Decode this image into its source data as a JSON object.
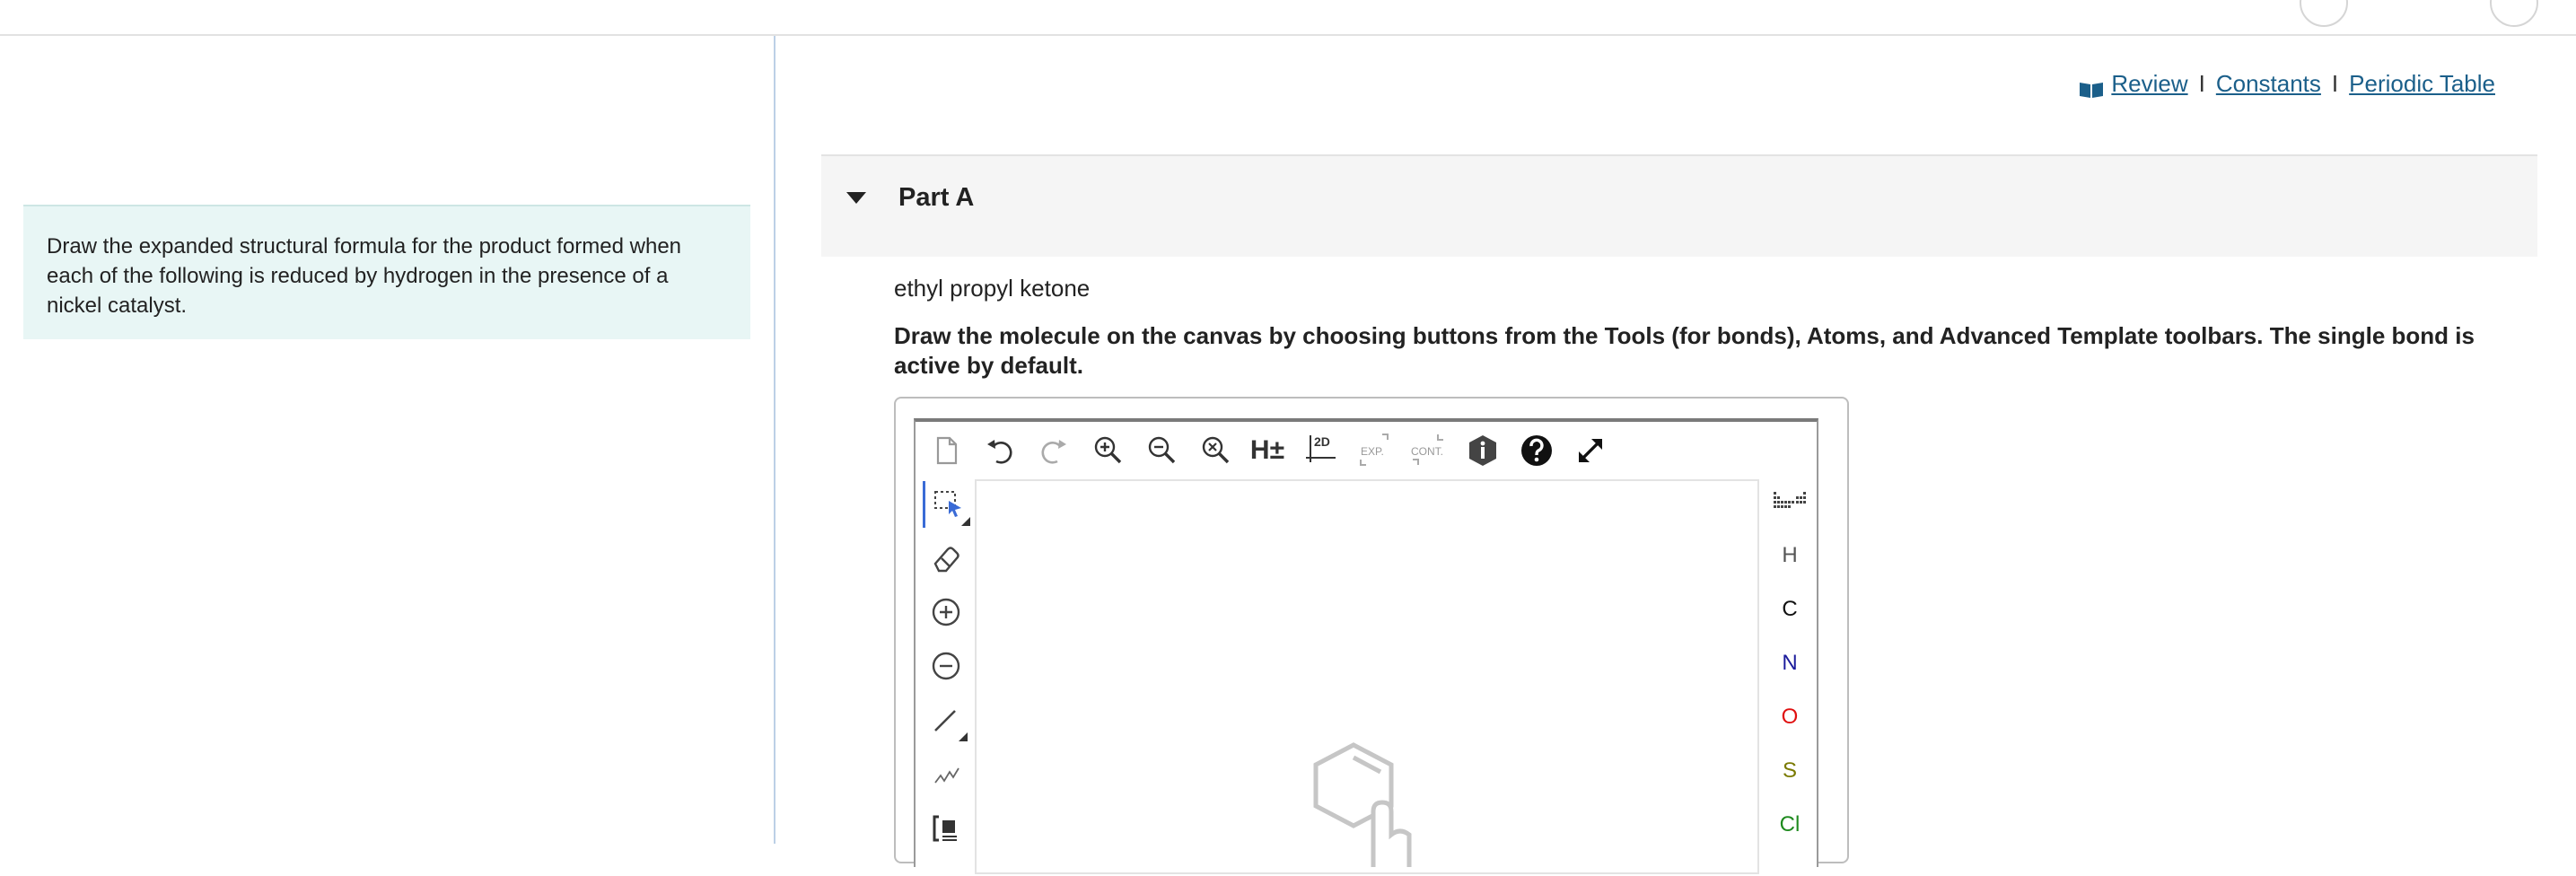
{
  "header": {},
  "left_panel": {
    "instruction": "Draw the expanded structural formula for the product formed when each of the following is reduced by hydrogen in the presence of a nickel catalyst."
  },
  "links": {
    "review": "Review",
    "constants": "Constants",
    "periodic_table": "Periodic Table",
    "separator": "I"
  },
  "part": {
    "title": "Part A",
    "question": "ethyl propyl ketone",
    "instructions": "Draw the molecule on the canvas by choosing buttons from the Tools (for bonds), Atoms, and Advanced Template toolbars. The single bond is active by default."
  },
  "editor": {
    "toolbar": {
      "h_label": "H±",
      "twod_label": "2D",
      "exp_label": "EXP.",
      "cont_label": "CONT."
    },
    "atoms": [
      {
        "symbol": "H",
        "color": "#555555"
      },
      {
        "symbol": "C",
        "color": "#111111"
      },
      {
        "symbol": "N",
        "color": "#1c1c9c"
      },
      {
        "symbol": "O",
        "color": "#e01010"
      },
      {
        "symbol": "S",
        "color": "#7a7a00"
      },
      {
        "symbol": "Cl",
        "color": "#1e8a1e"
      }
    ]
  },
  "colors": {
    "link": "#1b5f8a",
    "instruction_bg": "#e8f6f5",
    "active_tool": "#3a6bd6"
  }
}
